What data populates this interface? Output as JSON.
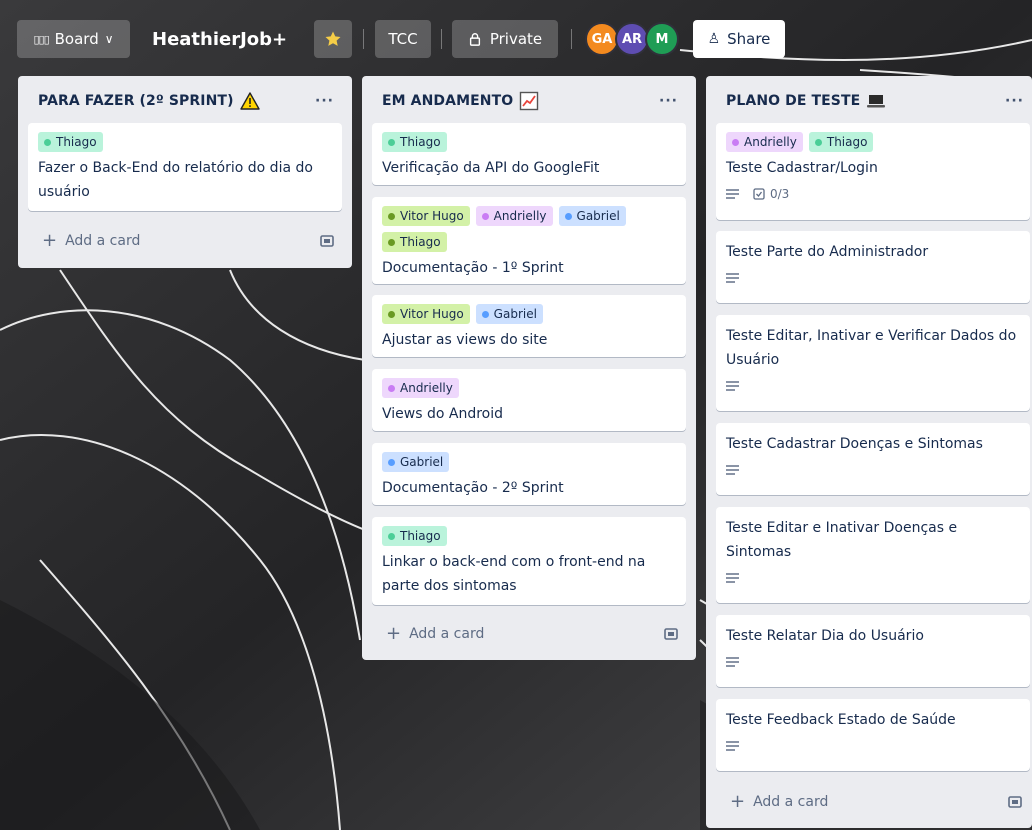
{
  "topbar": {
    "view_label": "Board",
    "board_title": "HeathierJob+",
    "workspace_label": "TCC",
    "visibility_label": "Private",
    "share_label": "Share",
    "members": [
      {
        "initials": "GA",
        "color": "#f38a1f"
      },
      {
        "initials": "AR",
        "color": "#5e4db2"
      },
      {
        "initials": "M",
        "color": "#1f9d55"
      }
    ]
  },
  "lists": [
    {
      "title": "PARA FAZER (2º SPRINT)",
      "title_icon": "warning-icon",
      "add_card_label": "Add a card",
      "cards": [
        {
          "labels": [
            "Thiago"
          ],
          "title": "Fazer o Back-End do relatório do dia do usuário"
        }
      ]
    },
    {
      "title": "EM ANDAMENTO",
      "title_icon": "chart-icon",
      "add_card_label": "Add a card",
      "cards": [
        {
          "labels": [
            "Thiago"
          ],
          "title": "Verificação da API do GoogleFit"
        },
        {
          "labels": [
            "Vitor Hugo",
            "Andrielly",
            "Gabriel",
            "Thiago"
          ],
          "title": "Documentação - 1º Sprint"
        },
        {
          "labels": [
            "Vitor Hugo",
            "Gabriel"
          ],
          "title": "Ajustar as views do site"
        },
        {
          "labels": [
            "Andrielly"
          ],
          "title": "Views do Android"
        },
        {
          "labels": [
            "Gabriel"
          ],
          "title": "Documentação - 2º Sprint"
        },
        {
          "labels": [
            "Thiago"
          ],
          "title": "Linkar o back-end com o front-end na parte dos sintomas"
        }
      ]
    },
    {
      "title": "PLANO DE TESTE",
      "title_icon": "laptop-icon",
      "add_card_label": "Add a card",
      "cards": [
        {
          "labels": [
            "Andrielly",
            "Thiago"
          ],
          "title": "Teste Cadastrar/Login",
          "checklist": "0/3"
        },
        {
          "title": "Teste Parte do Administrador"
        },
        {
          "title": "Teste Editar, Inativar e Verificar Dados do Usuário"
        },
        {
          "title": "Teste Cadastrar Doenças e Sintomas"
        },
        {
          "title": "Teste Editar e Inativar Doenças e Sintomas"
        },
        {
          "title": "Teste Relatar Dia do Usuário"
        },
        {
          "title": "Teste Feedback Estado de Saúde"
        }
      ]
    }
  ],
  "label_colors": {
    "Thiago": "#baf3db",
    "Vitor Hugo": "#d3f1a7",
    "Andrielly": "#eed7fc",
    "Gabriel": "#cce0ff"
  }
}
